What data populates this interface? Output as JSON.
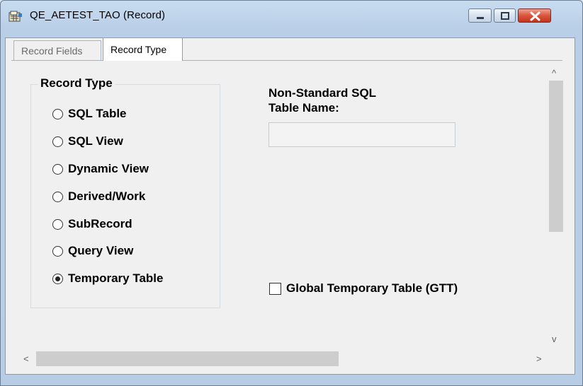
{
  "window": {
    "title": "QE_AETEST_TAO (Record)",
    "accent": "#c8dcf0",
    "close_color": "#d9563f",
    "icons": [
      "record-app-icon",
      "minimize-icon",
      "maximize-icon",
      "close-icon"
    ]
  },
  "tabs": [
    {
      "label": "Record Fields",
      "active": false
    },
    {
      "label": "Record Type",
      "active": true
    }
  ],
  "record_type": {
    "group_label": "Record Type",
    "options": [
      {
        "label": "SQL Table",
        "selected": false
      },
      {
        "label": "SQL View",
        "selected": false
      },
      {
        "label": "Dynamic View",
        "selected": false
      },
      {
        "label": "Derived/Work",
        "selected": false
      },
      {
        "label": "SubRecord",
        "selected": false
      },
      {
        "label": "Query View",
        "selected": false
      },
      {
        "label": "Temporary Table",
        "selected": true
      }
    ]
  },
  "sql_table": {
    "label_line1": "Non-Standard SQL",
    "label_line2": "Table Name:",
    "value": ""
  },
  "gtt": {
    "label": "Global Temporary Table (GTT)",
    "checked": false
  },
  "scrollbars": {
    "up": "^",
    "down": "v",
    "left": "<",
    "right": ">"
  }
}
